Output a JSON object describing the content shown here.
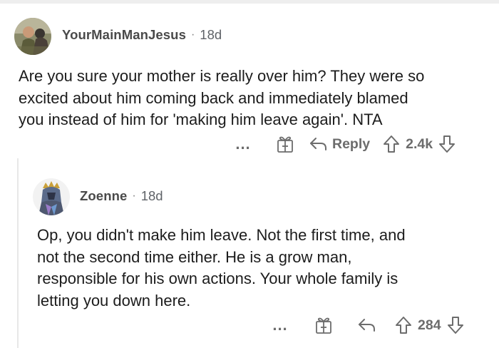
{
  "comment": {
    "username": "YourMainManJesus",
    "separator": "·",
    "age": "18d",
    "text": "Are you sure your mother is really over him? They were so\nexcited about him coming back and immediately blamed\nyou instead of him for 'making him leave again'. NTA",
    "actions": {
      "more_label": "...",
      "award_icon": "gift-icon",
      "reply_icon": "reply-arrow-icon",
      "reply_label": "Reply",
      "upvote_icon": "upvote-arrow-icon",
      "score": "2.4k",
      "downvote_icon": "downvote-arrow-icon"
    }
  },
  "reply": {
    "username": "Zoenne",
    "separator": "·",
    "age": "18d",
    "text": "Op, you didn't make him leave. Not the first time, and\nnot the second time either.  He is a grow man,\nresponsible for his own actions. Your whole family is\nletting you down here.",
    "actions": {
      "more_label": "...",
      "award_icon": "gift-icon",
      "reply_icon": "reply-arrow-icon",
      "upvote_icon": "upvote-arrow-icon",
      "score": "284",
      "downvote_icon": "downvote-arrow-icon"
    }
  },
  "colors": {
    "text": "#1c1c1c",
    "meta": "#6c6c6c",
    "thread_line": "#e8e8e8"
  }
}
